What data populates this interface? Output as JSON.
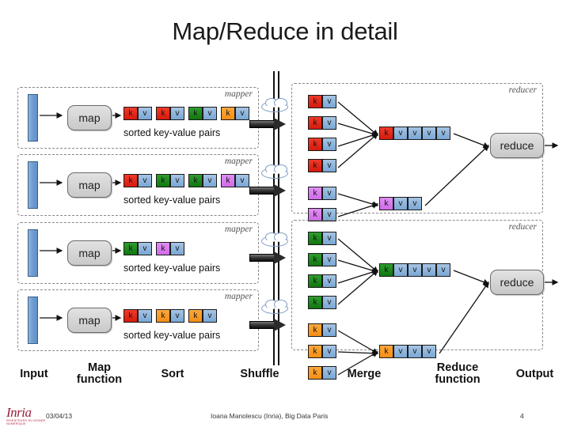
{
  "slide": {
    "title": "Map/Reduce in detail"
  },
  "mappers": [
    {
      "label": "mapper",
      "map_label": "map",
      "caption": "sorted key-value pairs",
      "pairs": [
        {
          "key_color": "red",
          "key": "k",
          "value": "v"
        },
        {
          "key_color": "red",
          "key": "k",
          "value": "v"
        },
        {
          "key_color": "green",
          "key": "k",
          "value": "v"
        },
        {
          "key_color": "orange",
          "key": "k",
          "value": "v"
        }
      ]
    },
    {
      "label": "mapper",
      "map_label": "map",
      "caption": "sorted key-value pairs",
      "pairs": [
        {
          "key_color": "red",
          "key": "k",
          "value": "v"
        },
        {
          "key_color": "green",
          "key": "k",
          "value": "v"
        },
        {
          "key_color": "green",
          "key": "k",
          "value": "v"
        },
        {
          "key_color": "violet",
          "key": "k",
          "value": "v"
        }
      ]
    },
    {
      "label": "mapper",
      "map_label": "map",
      "caption": "sorted key-value pairs",
      "pairs": [
        {
          "key_color": "green",
          "key": "k",
          "value": "v"
        },
        {
          "key_color": "violet",
          "key": "k",
          "value": "v"
        }
      ]
    },
    {
      "label": "mapper",
      "map_label": "map",
      "caption": "sorted key-value pairs",
      "pairs": [
        {
          "key_color": "red",
          "key": "k",
          "value": "v"
        },
        {
          "key_color": "orange",
          "key": "k",
          "value": "v"
        },
        {
          "key_color": "orange",
          "key": "k",
          "value": "v"
        }
      ]
    }
  ],
  "reducers": [
    {
      "label": "reducer",
      "reduce_label": "reduce",
      "groups": [
        {
          "key_color": "red",
          "key": "k",
          "value": "v",
          "incoming_count": 4,
          "merged_values": 4
        },
        {
          "key_color": "violet",
          "key": "k",
          "value": "v",
          "incoming_count": 2,
          "merged_values": 2
        }
      ]
    },
    {
      "label": "reducer",
      "reduce_label": "reduce",
      "groups": [
        {
          "key_color": "green",
          "key": "k",
          "value": "v",
          "incoming_count": 4,
          "merged_values": 4
        },
        {
          "key_color": "orange",
          "key": "k",
          "value": "v",
          "incoming_count": 3,
          "merged_values": 3
        }
      ]
    }
  ],
  "stages": [
    {
      "line1": "Input",
      "line2": ""
    },
    {
      "line1": "Map",
      "line2": "function"
    },
    {
      "line1": "Sort",
      "line2": ""
    },
    {
      "line1": "Shuffle",
      "line2": ""
    },
    {
      "line1": "Merge",
      "line2": ""
    },
    {
      "line1": "Reduce",
      "line2": "function"
    },
    {
      "line1": "Output",
      "line2": ""
    }
  ],
  "footer": {
    "date": "03/04/13",
    "center": "Ioana Manolescu (Inria), Big Data Paris",
    "page": "4",
    "logo_word": "Inria",
    "logo_sub": "INVENTEURS DU MONDE NUMÉRIQUE"
  },
  "colors": {
    "key_red": "#e22a16",
    "key_green": "#179017",
    "key_orange": "#f89a26",
    "key_violet": "#d97cf0",
    "value_blue": "#8fb1d9",
    "input_blue": "#6f9ed1",
    "box_gray": "#d4d4d4",
    "logo_red": "#9b1c3a"
  }
}
